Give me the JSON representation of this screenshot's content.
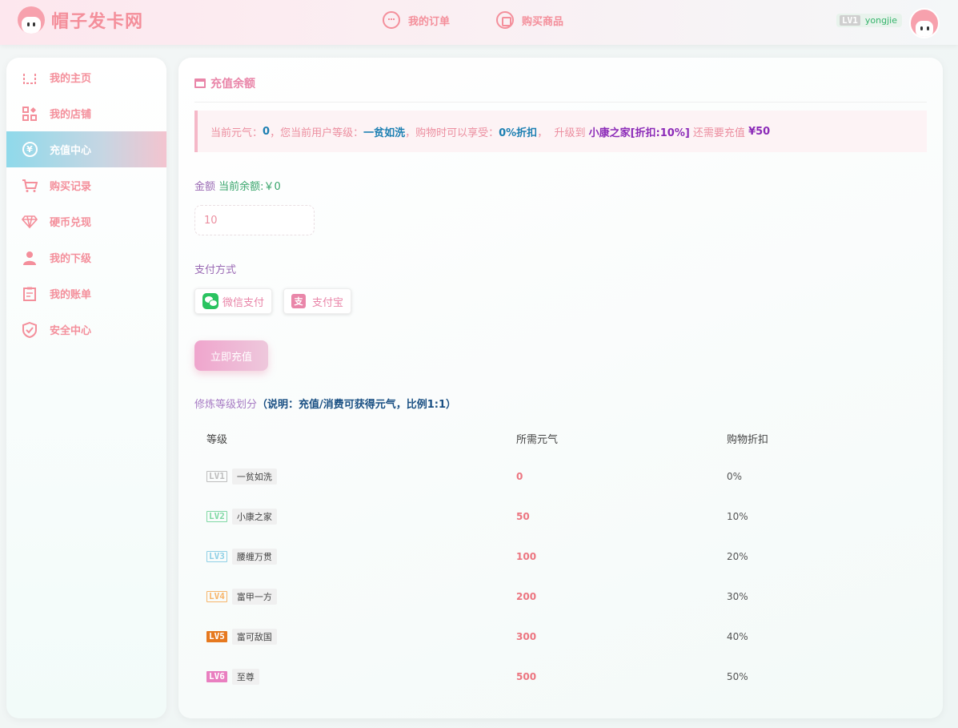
{
  "header": {
    "site_name": "帽子发卡网",
    "nav": [
      {
        "label": "我的订单",
        "icon": "chat-bubble-icon"
      },
      {
        "label": "购买商品",
        "icon": "shopping-bag-icon"
      }
    ],
    "user": {
      "level": "LV1",
      "name": "yongjie"
    }
  },
  "sidebar": {
    "items": [
      {
        "label": "我的主页",
        "icon": "home-icon"
      },
      {
        "label": "我的店铺",
        "icon": "shop-grid-icon"
      },
      {
        "label": "充值中心",
        "icon": "yen-circle-icon",
        "active": true
      },
      {
        "label": "购买记录",
        "icon": "cart-icon"
      },
      {
        "label": "硬币兑现",
        "icon": "diamond-icon"
      },
      {
        "label": "我的下级",
        "icon": "user-icon"
      },
      {
        "label": "我的账单",
        "icon": "clipboard-icon"
      },
      {
        "label": "安全中心",
        "icon": "shield-check-icon"
      }
    ]
  },
  "main": {
    "title": "充值余额",
    "notice": {
      "p1": "当前元气：",
      "energy": "0",
      "p2": "，您当前用户等级：",
      "level": "一贫如洗",
      "p3": "，购物时可以享受：",
      "discount": "0%折扣",
      "p4": "，  升级到 ",
      "next_level": "小康之家[折扣:10%]",
      "p5": " 还需要充值 ",
      "needed": "¥50"
    },
    "amount_label": "金额",
    "balance_text": "当前余额:￥0",
    "amount_value": "10",
    "pay_label": "支付方式",
    "pay_methods": [
      {
        "label": "微信支付",
        "icon": "wechat-icon"
      },
      {
        "label": "支付宝",
        "icon": "alipay-icon"
      }
    ],
    "submit_label": "立即充值",
    "level_title": "修炼等级划分",
    "level_note": "（说明：充值/消费可获得元气，比例1:1）",
    "table": {
      "headers": [
        "等级",
        "所需元气",
        "购物折扣"
      ],
      "rows": [
        {
          "lv": "LV1",
          "name": "一贫如洗",
          "energy": "0",
          "discount": "0%",
          "color": "#bdbdbd"
        },
        {
          "lv": "LV2",
          "name": "小康之家",
          "energy": "50",
          "discount": "10%",
          "color": "#7fd8a4"
        },
        {
          "lv": "LV3",
          "name": "腰缠万贯",
          "energy": "100",
          "discount": "20%",
          "color": "#8fd0e6"
        },
        {
          "lv": "LV4",
          "name": "富甲一方",
          "energy": "200",
          "discount": "30%",
          "color": "#f7b56a"
        },
        {
          "lv": "LV5",
          "name": "富可敌国",
          "energy": "300",
          "discount": "40%",
          "color": "#e6791f"
        },
        {
          "lv": "LV6",
          "name": "至尊",
          "energy": "500",
          "discount": "50%",
          "color": "#e97fc0"
        }
      ]
    }
  }
}
